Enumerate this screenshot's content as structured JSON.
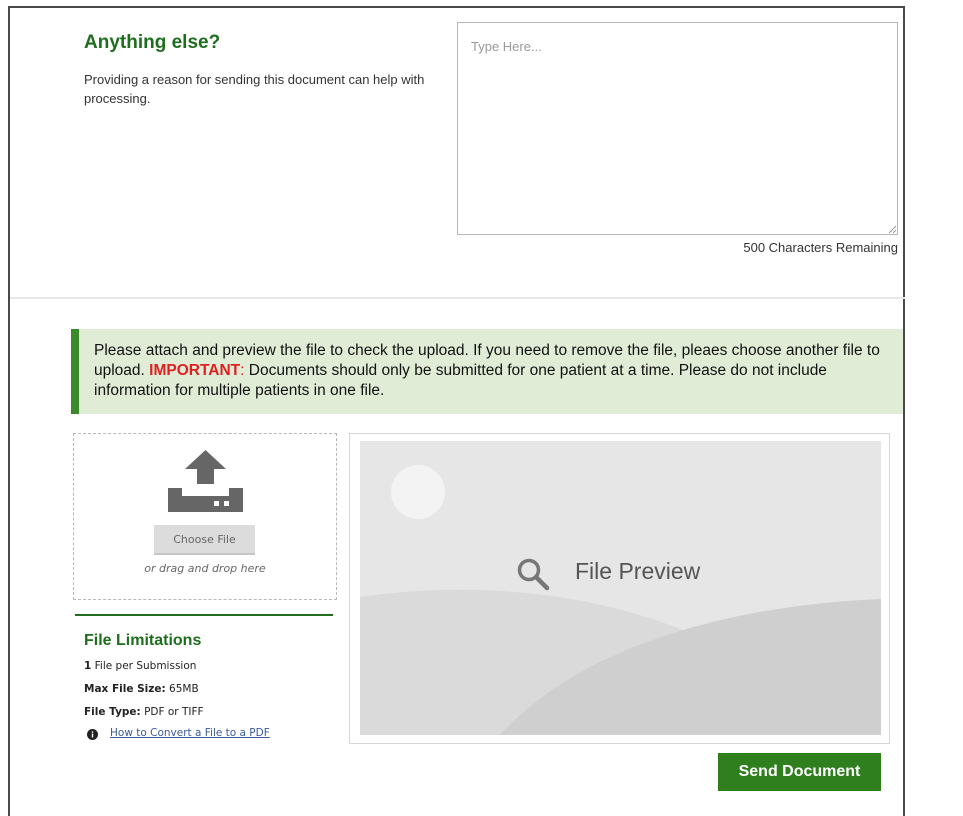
{
  "reason_section": {
    "heading": "Anything else?",
    "description": "Providing a reason for sending this document can help with processing.",
    "textarea_placeholder": "Type Here...",
    "textarea_value": "",
    "characters_remaining": "500 Characters Remaining"
  },
  "notice": {
    "text_before": "Please attach and preview the file to check the upload. If you need to remove the file, pleaes choose another file to upload.",
    "important_label": "IMPORTANT",
    "colon": ":",
    "text_after": " Documents should only be submitted for one patient at a time. Please do not include information for multiple patients in one file."
  },
  "upload": {
    "icon": "upload-icon",
    "choose_file_label": "Choose File",
    "drag_drop_text": "or drag and drop here"
  },
  "limitations": {
    "title": "File Limitations",
    "files_count_value": "1",
    "files_count_label": " File per Submission",
    "max_size_label": "Max File Size:",
    "max_size_value": " 65MB",
    "file_type_label": "File Type:",
    "file_type_value": " PDF or TIFF",
    "info_icon": "info-icon",
    "convert_link": "How to Convert a File to a PDF"
  },
  "preview": {
    "icon": "search-icon",
    "label": "File Preview"
  },
  "actions": {
    "send_label": "Send Document"
  },
  "colors": {
    "accent_green": "#1e6e1e",
    "button_green": "#2f7f1e",
    "notice_background": "#e0ecd6",
    "important_red": "#e02020"
  }
}
